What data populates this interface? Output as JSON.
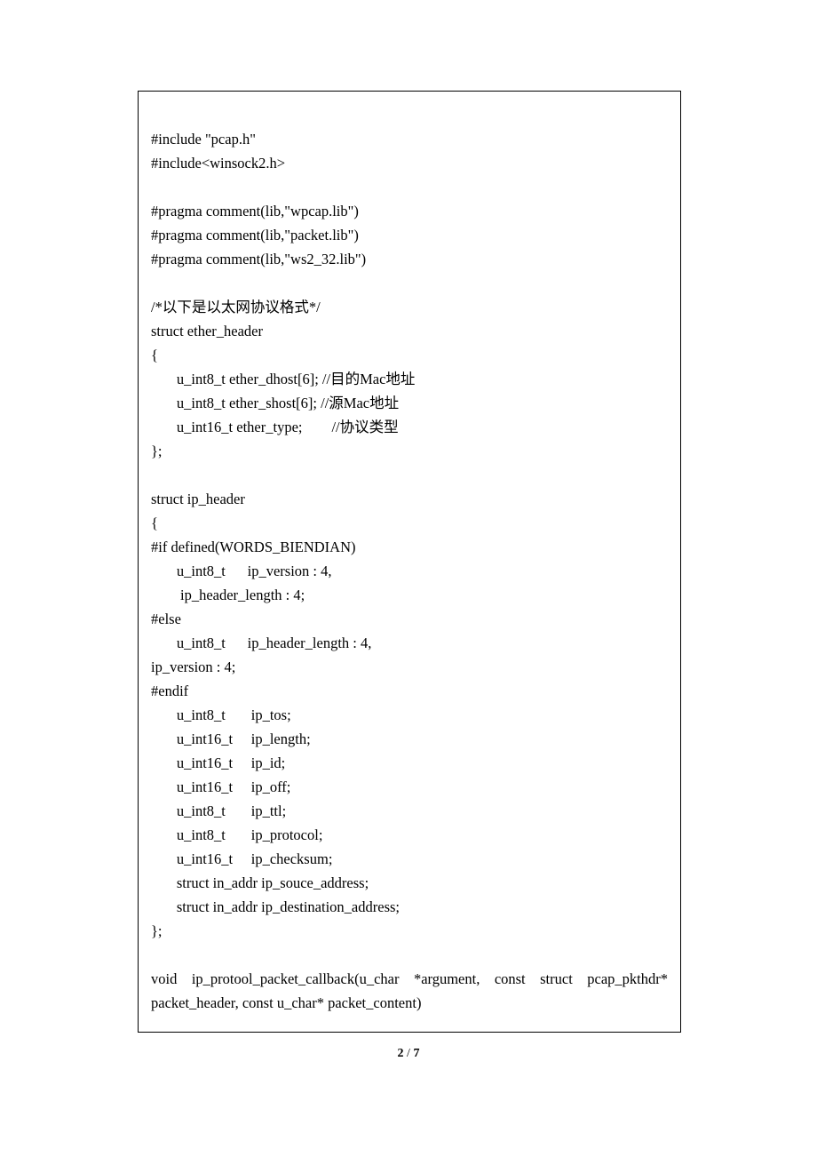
{
  "code": {
    "lines": [
      "#include \"pcap.h\"",
      "#include<winsock2.h>",
      "",
      "#pragma comment(lib,\"wpcap.lib\")",
      "#pragma comment(lib,\"packet.lib\")",
      "#pragma comment(lib,\"ws2_32.lib\")",
      "",
      "/*以下是以太网协议格式*/",
      "struct ether_header",
      "{",
      "       u_int8_t ether_dhost[6]; //目的Mac地址",
      "       u_int8_t ether_shost[6]; //源Mac地址",
      "       u_int16_t ether_type;        //协议类型",
      "};",
      "",
      "struct ip_header",
      "{",
      "#if defined(WORDS_BIENDIAN)",
      "       u_int8_t      ip_version : 4,",
      "        ip_header_length : 4;",
      "#else",
      "       u_int8_t      ip_header_length : 4,",
      "ip_version : 4;",
      "#endif",
      "       u_int8_t       ip_tos;",
      "       u_int16_t     ip_length;",
      "       u_int16_t     ip_id;",
      "       u_int16_t     ip_off;",
      "       u_int8_t       ip_ttl;",
      "       u_int8_t       ip_protocol;",
      "       u_int16_t     ip_checksum;",
      "       struct in_addr ip_souce_address;",
      "       struct in_addr ip_destination_address;",
      "};",
      ""
    ],
    "justified_line": "void   ip_protool_packet_callback(u_char   *argument,   const   struct   pcap_pkthdr*",
    "last_line": "packet_header, const u_char* packet_content)"
  },
  "page": {
    "current": "2",
    "separator": " / ",
    "total": "7"
  }
}
